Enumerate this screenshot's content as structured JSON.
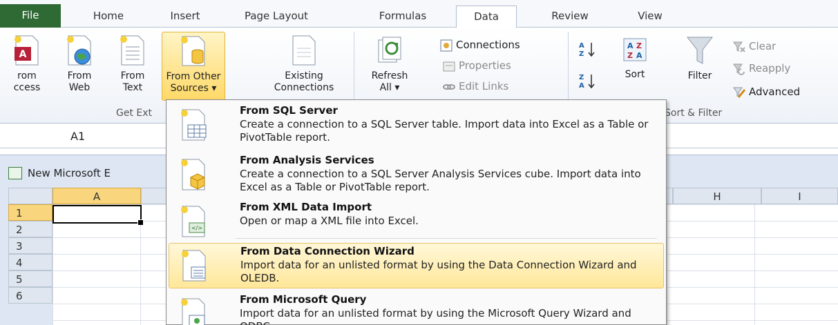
{
  "tabs": [
    "File",
    "Home",
    "Insert",
    "Page Layout",
    "Formulas",
    "Data",
    "Review",
    "View"
  ],
  "active_tab": "Data",
  "ribbon": {
    "from_access": [
      "rom",
      "ccess"
    ],
    "from_web": [
      "From",
      "Web"
    ],
    "from_text": [
      "From",
      "Text"
    ],
    "from_other": [
      "From Other",
      "Sources ▾"
    ],
    "existing": [
      "Existing",
      "Connections"
    ],
    "refresh": [
      "Refresh",
      "All ▾"
    ],
    "connections": "Connections",
    "properties": "Properties",
    "edit_links": "Edit Links",
    "sort": "Sort",
    "filter": "Filter",
    "clear": "Clear",
    "reapply": "Reapply",
    "advanced": "Advanced",
    "group_get_external": "Get Ext",
    "group_sort_filter": "Sort & Filter"
  },
  "name_box": "A1",
  "workbook_title": "New Microsoft E",
  "columns": [
    "A",
    "H",
    "I"
  ],
  "rows": [
    "1",
    "2",
    "3",
    "4",
    "5",
    "6"
  ],
  "menu": [
    {
      "title": "From SQL Server",
      "desc": "Create a connection to a SQL Server table. Import data into Excel as a Table or PivotTable report."
    },
    {
      "title": "From Analysis Services",
      "desc": "Create a connection to a SQL Server Analysis Services cube. Import data into Excel as a Table or PivotTable report."
    },
    {
      "title": "From XML Data Import",
      "desc": "Open or map a XML file into Excel."
    },
    {
      "title": "From Data Connection Wizard",
      "desc": "Import data for an unlisted format by using the Data Connection Wizard and OLEDB."
    },
    {
      "title": "From Microsoft Query",
      "desc": "Import data for an unlisted format by using the Microsoft Query Wizard and ODBC."
    }
  ],
  "colors": {
    "file_tab": "#2f6a35",
    "highlight": "#ffe79a",
    "selected_header": "#f9d57e"
  }
}
